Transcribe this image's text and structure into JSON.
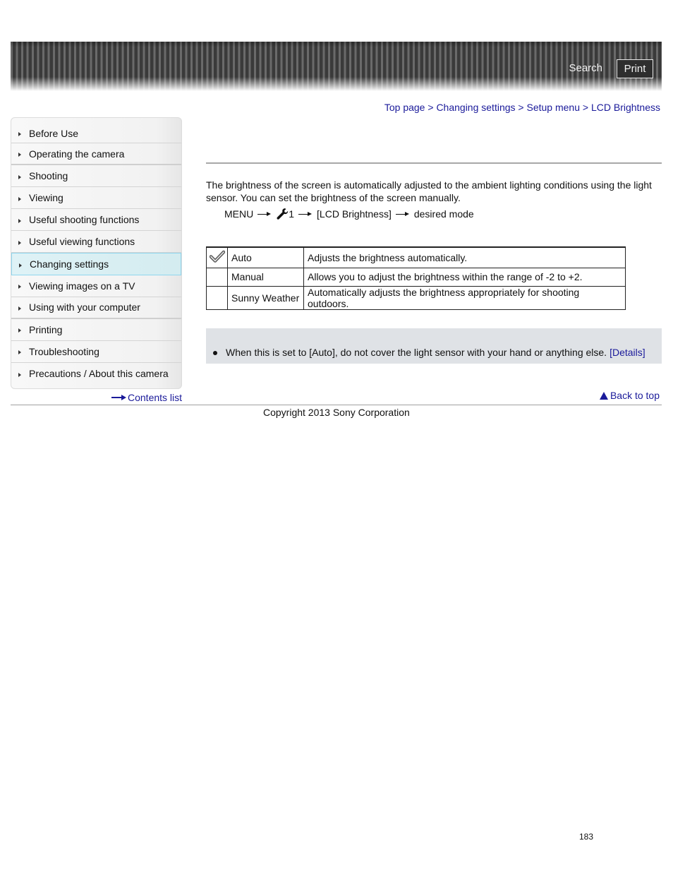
{
  "header": {
    "search_label": "Search",
    "print_label": "Print"
  },
  "breadcrumb": {
    "items": [
      "Top page",
      "Changing settings",
      "Setup menu",
      "LCD Brightness"
    ],
    "separator": ">"
  },
  "sidebar": {
    "items": [
      {
        "label": "Before Use"
      },
      {
        "label": "Operating the camera"
      },
      {
        "label": "Shooting"
      },
      {
        "label": "Viewing"
      },
      {
        "label": "Useful shooting functions"
      },
      {
        "label": "Useful viewing functions"
      },
      {
        "label": "Changing settings",
        "active": true
      },
      {
        "label": "Viewing images on a TV"
      },
      {
        "label": "Using with your computer"
      },
      {
        "label": "Printing"
      },
      {
        "label": "Troubleshooting"
      },
      {
        "label": "Precautions / About this camera"
      }
    ],
    "contents_list_label": "Contents list"
  },
  "main": {
    "intro": "The brightness of the screen is automatically adjusted to the ambient lighting conditions using the light sensor. You can set the brightness of the screen manually.",
    "menu_path": {
      "menu": "MENU",
      "setup_number": "1",
      "item": "[LCD Brightness]",
      "final": "desired mode",
      "icon": "wrench-icon"
    },
    "table": {
      "rows": [
        {
          "default": true,
          "icon": "checkmark-icon",
          "name": "Auto",
          "description": "Adjusts the brightness automatically."
        },
        {
          "default": false,
          "name": "Manual",
          "description": "Allows you to adjust the brightness within the range of -2 to +2."
        },
        {
          "default": false,
          "name": "Sunny Weather",
          "description": "Automatically adjusts the brightness appropriately for shooting outdoors."
        }
      ]
    },
    "note": {
      "text": "When this is set to [Auto], do not cover the light sensor with your hand or anything else.",
      "link_label": "[Details]"
    },
    "back_to_top_label": "Back to top"
  },
  "footer": {
    "copyright": "Copyright 2013 Sony Corporation",
    "page_number": "183"
  },
  "colors": {
    "link": "#1a1a9a",
    "active_nav_bg": "#dff2f6",
    "active_nav_border": "#8fd6ee",
    "note_bg": "#dfe2e6"
  }
}
